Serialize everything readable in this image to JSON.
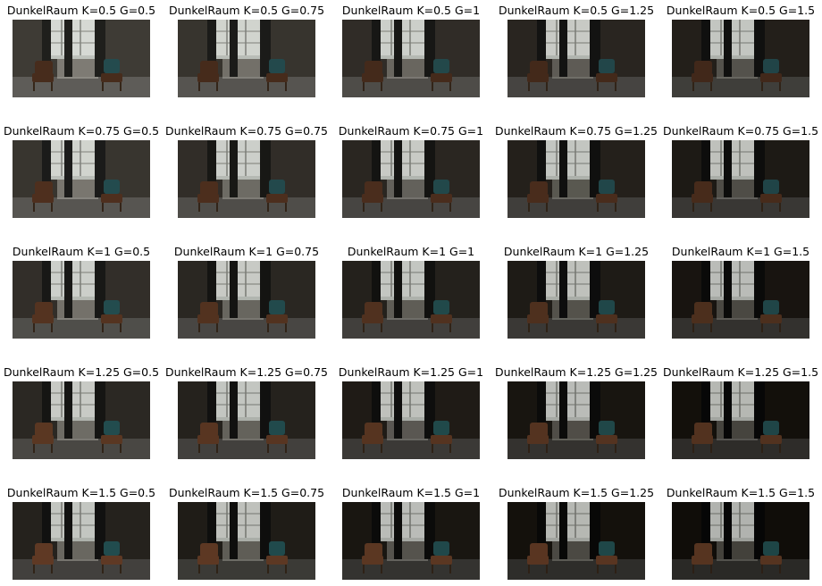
{
  "figure": {
    "panels": [
      {
        "title": "DunkelRaum K=0.5 G=0.5",
        "k": 0.5,
        "g": 0.5
      },
      {
        "title": "DunkelRaum K=0.5 G=0.75",
        "k": 0.5,
        "g": 0.75
      },
      {
        "title": "DunkelRaum K=0.5 G=1",
        "k": 0.5,
        "g": 1
      },
      {
        "title": "DunkelRaum K=0.5 G=1.25",
        "k": 0.5,
        "g": 1.25
      },
      {
        "title": "DunkelRaum K=0.5 G=1.5",
        "k": 0.5,
        "g": 1.5
      },
      {
        "title": "DunkelRaum K=0.75 G=0.5",
        "k": 0.75,
        "g": 0.5
      },
      {
        "title": "DunkelRaum K=0.75 G=0.75",
        "k": 0.75,
        "g": 0.75
      },
      {
        "title": "DunkelRaum K=0.75 G=1",
        "k": 0.75,
        "g": 1
      },
      {
        "title": "DunkelRaum K=0.75 G=1.25",
        "k": 0.75,
        "g": 1.25
      },
      {
        "title": "DunkelRaum K=0.75 G=1.5",
        "k": 0.75,
        "g": 1.5
      },
      {
        "title": "DunkelRaum K=1 G=0.5",
        "k": 1,
        "g": 0.5
      },
      {
        "title": "DunkelRaum K=1 G=0.75",
        "k": 1,
        "g": 0.75
      },
      {
        "title": "DunkelRaum K=1 G=1",
        "k": 1,
        "g": 1
      },
      {
        "title": "DunkelRaum K=1 G=1.25",
        "k": 1,
        "g": 1.25
      },
      {
        "title": "DunkelRaum K=1 G=1.5",
        "k": 1,
        "g": 1.5
      },
      {
        "title": "DunkelRaum K=1.25 G=0.5",
        "k": 1.25,
        "g": 0.5
      },
      {
        "title": "DunkelRaum K=1.25 G=0.75",
        "k": 1.25,
        "g": 0.75
      },
      {
        "title": "DunkelRaum K=1.25 G=1",
        "k": 1.25,
        "g": 1
      },
      {
        "title": "DunkelRaum K=1.25 G=1.25",
        "k": 1.25,
        "g": 1.25
      },
      {
        "title": "DunkelRaum K=1.25 G=1.5",
        "k": 1.25,
        "g": 1.5
      },
      {
        "title": "DunkelRaum K=1.5 G=0.5",
        "k": 1.5,
        "g": 0.5
      },
      {
        "title": "DunkelRaum K=1.5 G=0.75",
        "k": 1.5,
        "g": 0.75
      },
      {
        "title": "DunkelRaum K=1.5 G=1",
        "k": 1.5,
        "g": 1
      },
      {
        "title": "DunkelRaum K=1.5 G=1.25",
        "k": 1.5,
        "g": 1.25
      },
      {
        "title": "DunkelRaum K=1.5 G=1.5",
        "k": 1.5,
        "g": 1.5
      }
    ]
  }
}
